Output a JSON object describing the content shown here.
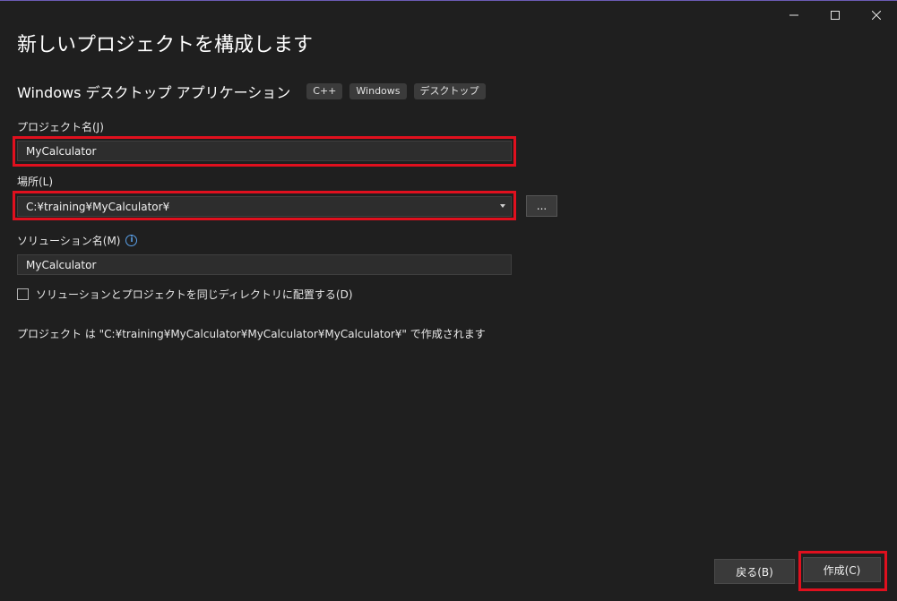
{
  "window": {
    "minimize_icon": "minimize-icon",
    "maximize_icon": "maximize-icon",
    "close_icon": "close-icon"
  },
  "header": {
    "title": "新しいプロジェクトを構成します"
  },
  "template": {
    "name": "Windows デスクトップ アプリケーション",
    "tags": [
      "C++",
      "Windows",
      "デスクトップ"
    ]
  },
  "project_name": {
    "label": "プロジェクト名(J)",
    "value": "MyCalculator"
  },
  "location": {
    "label": "場所(L)",
    "value": "C:¥training¥MyCalculator¥",
    "browse_label": "..."
  },
  "solution_name": {
    "label": "ソリューション名(M)",
    "value": "MyCalculator",
    "info_icon": "info-icon",
    "info_glyph": "i"
  },
  "same_directory": {
    "label": "ソリューションとプロジェクトを同じディレクトリに配置する(D)",
    "checked": false
  },
  "path_note": "プロジェクト は \"C:¥training¥MyCalculator¥MyCalculator¥MyCalculator¥\" で作成されます",
  "footer": {
    "back_label": "戻る(B)",
    "create_label": "作成(C)"
  },
  "colors": {
    "background": "#1f1f1f",
    "highlight": "#e0101e",
    "accent_border": "#6b5bb5"
  }
}
